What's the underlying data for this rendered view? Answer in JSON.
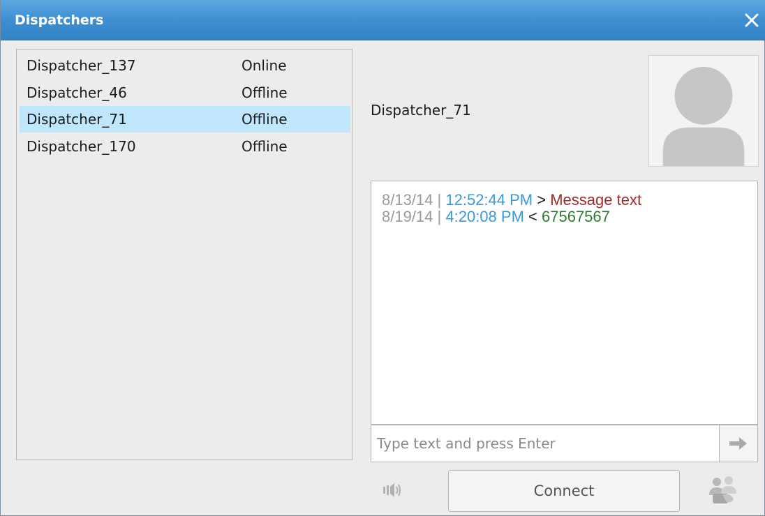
{
  "window": {
    "title": "Dispatchers",
    "close_icon": "close-icon"
  },
  "dispatchers": [
    {
      "name": "Dispatcher_137",
      "status": "Online",
      "selected": false
    },
    {
      "name": "Dispatcher_46",
      "status": "Offline",
      "selected": false
    },
    {
      "name": "Dispatcher_71",
      "status": "Offline",
      "selected": true
    },
    {
      "name": "Dispatcher_170",
      "status": "Offline",
      "selected": false
    }
  ],
  "selected_dispatcher": {
    "name": "Dispatcher_71",
    "avatar_icon": "user-avatar-icon"
  },
  "chat": {
    "messages": [
      {
        "date": "8/13/14",
        "sep": "|",
        "time": "12:52:44 PM",
        "direction": ">",
        "text": "Message text",
        "type": "outgoing"
      },
      {
        "date": "8/19/14",
        "sep": "|",
        "time": "4:20:08 PM",
        "direction": "<",
        "text": "67567567",
        "type": "incoming"
      }
    ],
    "input_placeholder": "Type text and press Enter",
    "input_value": "",
    "send_icon": "arrow-right-icon"
  },
  "actions": {
    "speaker_icon": "speaker-icon",
    "connect_label": "Connect",
    "group_call_icon": "group-call-icon"
  },
  "colors": {
    "titlebar": "#3e8ed2",
    "selected_row": "#bfe6fb",
    "time": "#3a9ad9",
    "outgoing": "#a12a2a",
    "incoming": "#2e7d32",
    "date": "#9a9a9a"
  }
}
